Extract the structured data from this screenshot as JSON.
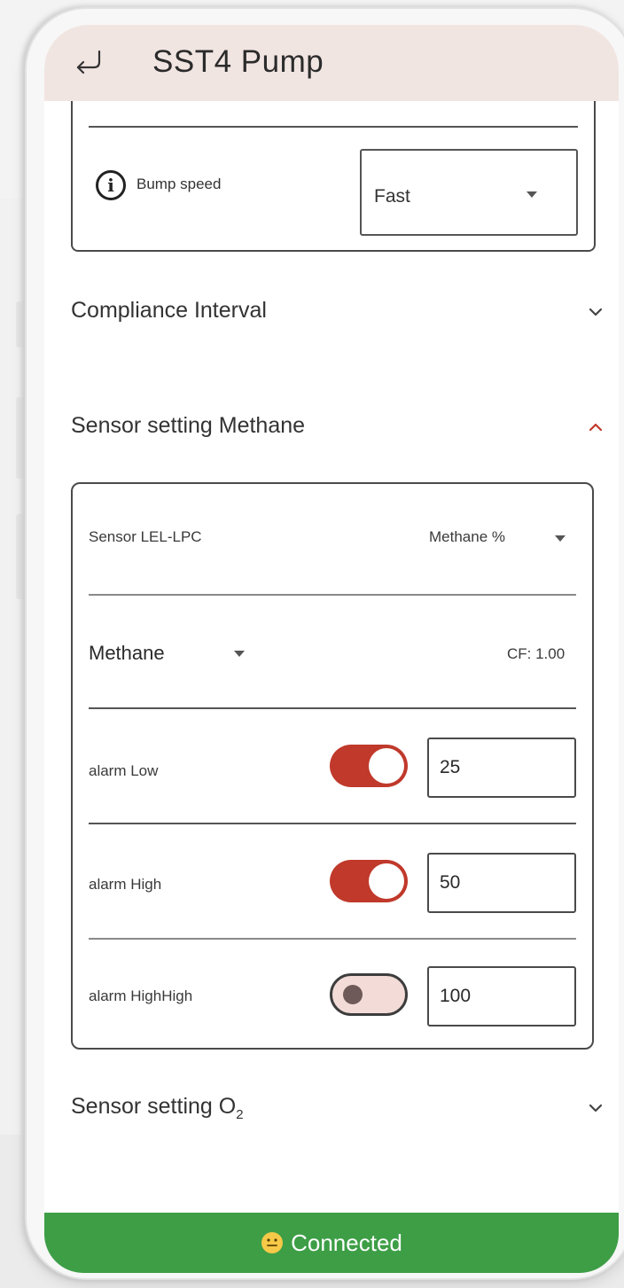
{
  "app": {
    "title": "SST4 Pump"
  },
  "bump": {
    "label": "Bump speed",
    "value": "Fast"
  },
  "sections": {
    "compliance": "Compliance Interval",
    "methane": "Sensor setting Methane",
    "o2_prefix": "Sensor setting O",
    "o2_sub": "2"
  },
  "sensor": {
    "label": "Sensor LEL-LPC",
    "gas_unit": "Methane  %",
    "gas": "Methane",
    "cf": "CF: 1.00"
  },
  "alarms": [
    {
      "label": "alarm Low",
      "enabled": true,
      "value": "25"
    },
    {
      "label": "alarm High",
      "enabled": true,
      "value": "50"
    },
    {
      "label": "alarm HighHigh",
      "enabled": false,
      "value": "100"
    }
  ],
  "status": {
    "text": "Connected",
    "color": "#3d9e46"
  },
  "colors": {
    "accent": "#c0392b",
    "appbar": "#f1e5e2"
  },
  "icons": [
    "back-icon",
    "info-icon",
    "chevron-down-icon",
    "chevron-up-icon",
    "dropdown-arrow-icon",
    "smiley-icon"
  ]
}
